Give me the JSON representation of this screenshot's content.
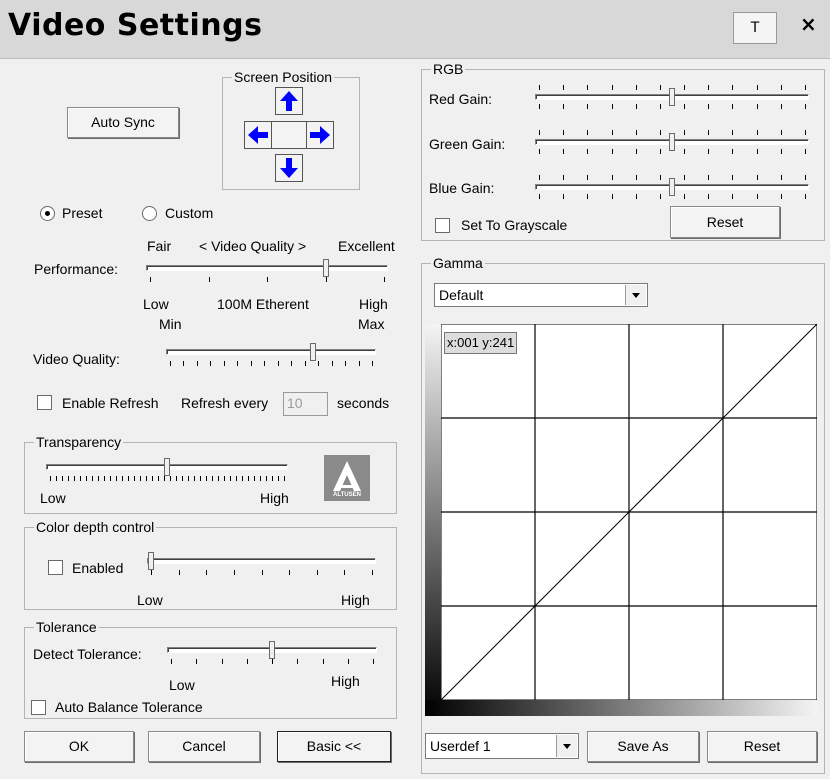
{
  "window": {
    "title": "Video Settings",
    "pin_label": "T",
    "close_label": "×"
  },
  "left": {
    "auto_sync_label": "Auto Sync",
    "screen_position": {
      "legend": "Screen Position"
    },
    "mode": {
      "preset_label": "Preset",
      "custom_label": "Custom",
      "selected": "Preset"
    },
    "performance": {
      "label": "Performance:",
      "top_left": "Fair",
      "top_center": "< Video Quality >",
      "top_right": "Excellent",
      "bottom_left": "Low",
      "bottom_center": "100M Etherent",
      "bottom_right": "High",
      "min_label": "Min",
      "max_label": "Max",
      "value": 0.75
    },
    "video_quality": {
      "label": "Video Quality:",
      "value": 0.71
    },
    "refresh": {
      "enable_label": "Enable Refresh",
      "every_label": "Refresh every",
      "input_value": "10",
      "unit_label": "seconds"
    },
    "transparency": {
      "legend": "Transparency",
      "low": "Low",
      "high": "High",
      "value": 0.5,
      "logo_text": "ALTUSEN"
    },
    "color_depth": {
      "legend": "Color depth control",
      "enabled_label": "Enabled",
      "low": "Low",
      "high": "High",
      "value": 0.0
    },
    "tolerance": {
      "legend": "Tolerance",
      "detect_label": "Detect Tolerance:",
      "low": "Low",
      "high": "High",
      "value": 0.5,
      "auto_balance_label": "Auto Balance Tolerance"
    },
    "buttons": {
      "ok": "OK",
      "cancel": "Cancel",
      "basic": "Basic <<"
    }
  },
  "right": {
    "rgb": {
      "legend": "RGB",
      "red_label": "Red Gain:",
      "green_label": "Green Gain:",
      "blue_label": "Blue Gain:",
      "red_value": 0.5,
      "green_value": 0.5,
      "blue_value": 0.5,
      "grayscale_label": "Set To Grayscale",
      "reset_label": "Reset"
    },
    "gamma": {
      "legend": "Gamma",
      "select_value": "Default",
      "coord_readout": "x:001 y:241",
      "profile_value": "Userdef 1",
      "save_as_label": "Save As",
      "reset_label": "Reset"
    }
  },
  "colors": {
    "arrow": "#0000ff",
    "grid_line": "#000000",
    "panel_bg": "#f0f0f0",
    "titlebar_bg": "#d8d8d8"
  },
  "icons": {
    "up": "arrow-up-icon",
    "down": "arrow-down-icon",
    "left": "arrow-left-icon",
    "right": "arrow-right-icon",
    "dropdown": "dropdown-arrow-icon"
  }
}
